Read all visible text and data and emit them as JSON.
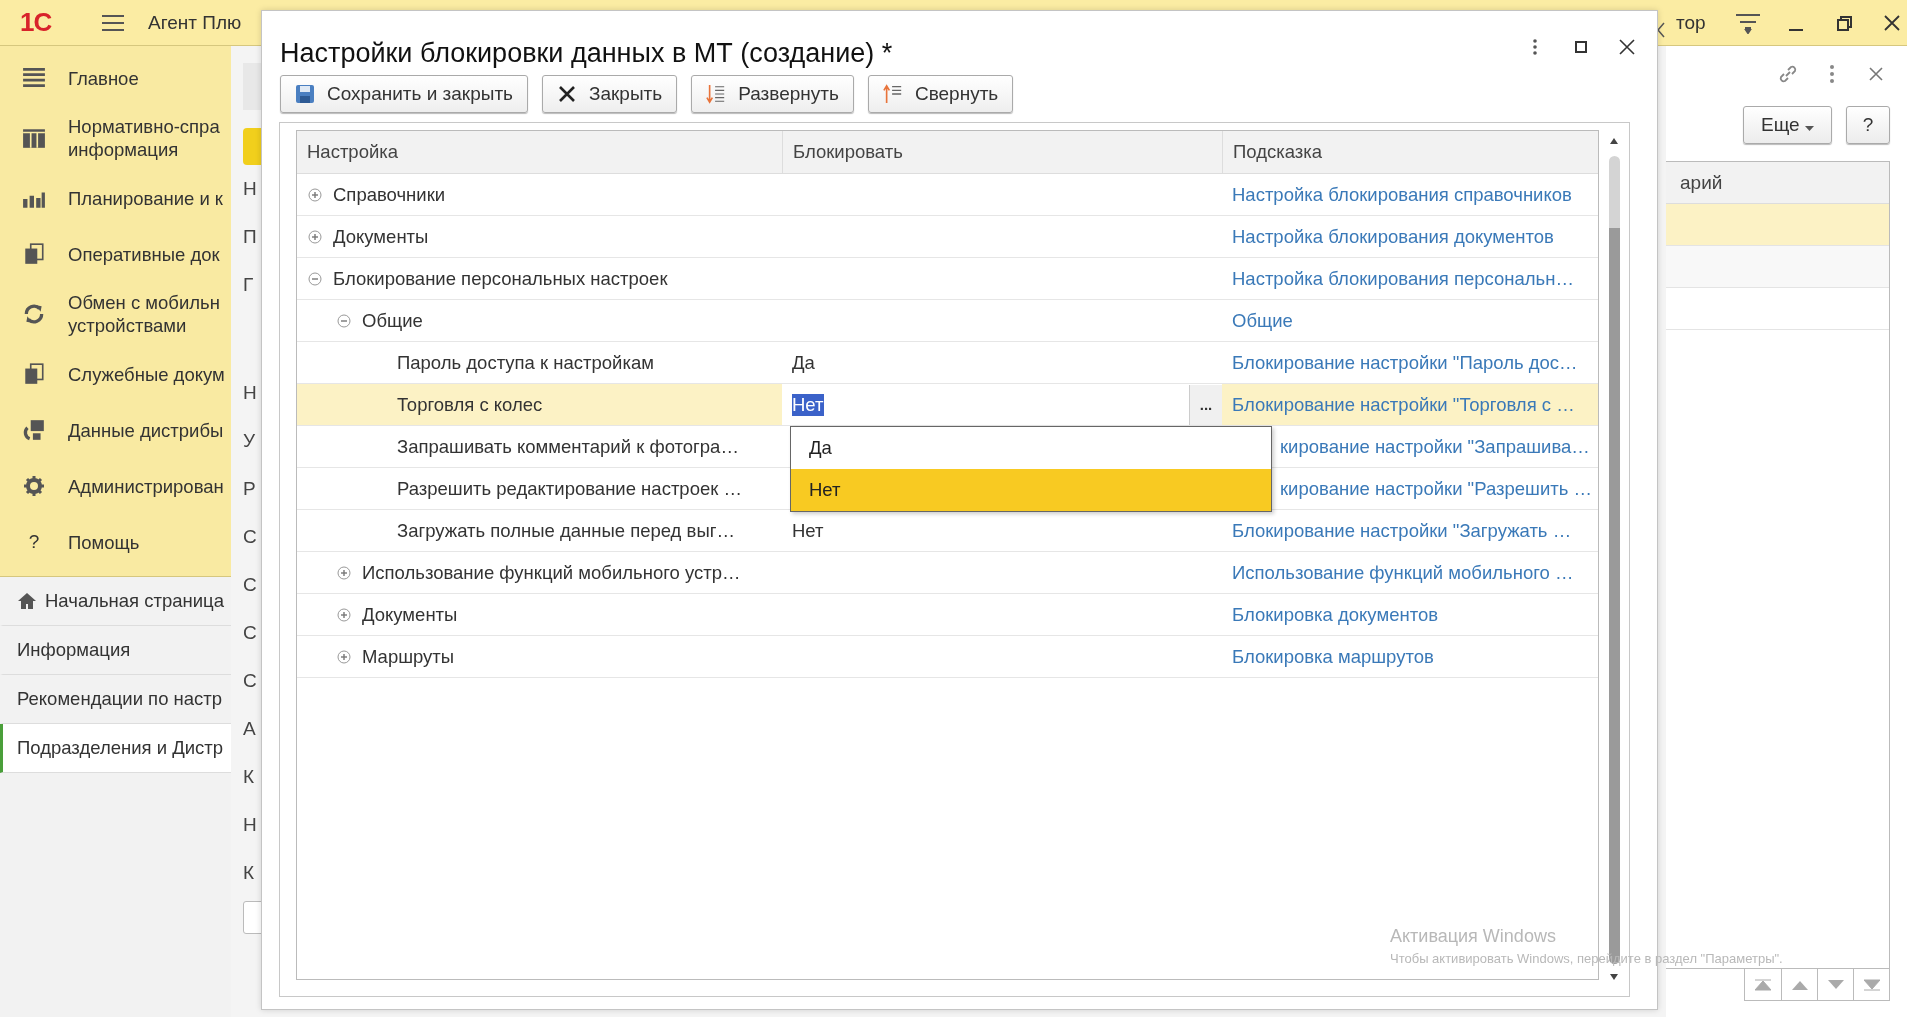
{
  "app_bar": {
    "logo": "1С",
    "title": "Агент Плю",
    "user": "тор"
  },
  "sidebar": {
    "sections": [
      {
        "label": "Главное",
        "kind": "lines"
      },
      {
        "label": "Нормативно-спра",
        "label2": "информация",
        "kind": "grid"
      },
      {
        "label": "Планирование и к",
        "kind": "chart"
      },
      {
        "label": "Оперативные док",
        "kind": "docs"
      },
      {
        "label": "Обмен с мобильн",
        "label2": "устройствами",
        "kind": "sync"
      },
      {
        "label": "Служебные докум",
        "kind": "docs2"
      },
      {
        "label": "Данные дистрибы",
        "kind": "distr"
      },
      {
        "label": "Администрирован",
        "kind": "gear"
      },
      {
        "label": "Помощь",
        "kind": "help",
        "icon_text": "?"
      }
    ],
    "open_pages": [
      {
        "label": "Начальная страница",
        "home": true,
        "selected": false
      },
      {
        "label": "Информация",
        "home": false,
        "selected": false
      },
      {
        "label": "Рекомендации по настр",
        "home": false,
        "selected": false
      },
      {
        "label": "Подразделения и Дистр",
        "home": false,
        "selected": true
      }
    ]
  },
  "background_form": {
    "labels_top": [
      "Н",
      "П",
      "Г"
    ],
    "labels_bottom": [
      "Н",
      "У",
      "Р",
      "С",
      "С",
      "С",
      "С",
      "А",
      "К",
      "Н",
      "К"
    ]
  },
  "right_panel": {
    "more_button": "Еще",
    "help_button": "?",
    "column_header": "арий",
    "rows": [
      {
        "selected": true
      },
      {
        "selected": false
      },
      {
        "selected": false
      }
    ]
  },
  "dialog": {
    "title": "Настройки блокировки данных в МТ (создание) *",
    "toolbar": [
      {
        "label": "Сохранить и закрыть",
        "kind": "save"
      },
      {
        "label": "Закрыть",
        "kind": "close"
      },
      {
        "label": "Развернуть",
        "kind": "expand"
      },
      {
        "label": "Свернуть",
        "kind": "collapse"
      }
    ],
    "table": {
      "columns": [
        "Настройка",
        "Блокировать",
        "Подсказка"
      ],
      "rows": [
        {
          "kind": "group",
          "setting": "Справочники",
          "hint": "Настройка блокирования справочников",
          "expanded": false,
          "selected": false
        },
        {
          "kind": "group",
          "setting": "Документы",
          "hint": "Настройка блокирования документов",
          "expanded": false,
          "selected": false
        },
        {
          "kind": "group",
          "setting": "Блокирование персональных настроек",
          "hint": "Настройка блокирования персональн…",
          "expanded": true,
          "selected": false,
          "children": [
            {
              "kind": "group",
              "setting": "Общие",
              "hint": "Общие",
              "expanded": true,
              "selected": false,
              "children": [
                {
                  "kind": "setting",
                  "setting": "Пароль доступа к настройкам",
                  "value": "Да",
                  "hint": "Блокирование настройки \"Пароль дос…",
                  "selected": false
                },
                {
                  "kind": "setting",
                  "setting": "Торговля с колес",
                  "value": "Нет",
                  "hint": "Блокирование настройки \"Торговля с …",
                  "selected": true
                },
                {
                  "kind": "setting",
                  "setting": "Запрашивать комментарий к фотогра…",
                  "hint": "кирование настройки \"Запрашива…",
                  "selected": false
                },
                {
                  "kind": "setting",
                  "setting": "Разрешить редактирование настроек …",
                  "hint": "кирование настройки \"Разрешить …",
                  "selected": false
                },
                {
                  "kind": "setting",
                  "setting": "Загружать полные данные перед выг…",
                  "value": "Нет",
                  "hint": "Блокирование настройки \"Загружать …",
                  "selected": false
                }
              ]
            },
            {
              "kind": "group",
              "setting": "Использование функций мобильного устр…",
              "hint": "Использование функций мобильного …",
              "expanded": false,
              "selected": false
            },
            {
              "kind": "group",
              "setting": "Документы",
              "hint": "Блокировка документов",
              "expanded": false,
              "selected": false
            },
            {
              "kind": "group",
              "setting": "Маршруты",
              "hint": "Блокировка маршрутов",
              "expanded": false,
              "selected": false
            }
          ]
        }
      ]
    },
    "choice_button": "...",
    "dropdown": {
      "options": [
        {
          "label": "Да",
          "selected": false
        },
        {
          "label": "Нет",
          "selected": true
        }
      ]
    }
  },
  "os_notice": {
    "title": "Активация Windows",
    "text": "Чтобы активировать Windows, перейдите в раздел \"Параметры\"."
  }
}
